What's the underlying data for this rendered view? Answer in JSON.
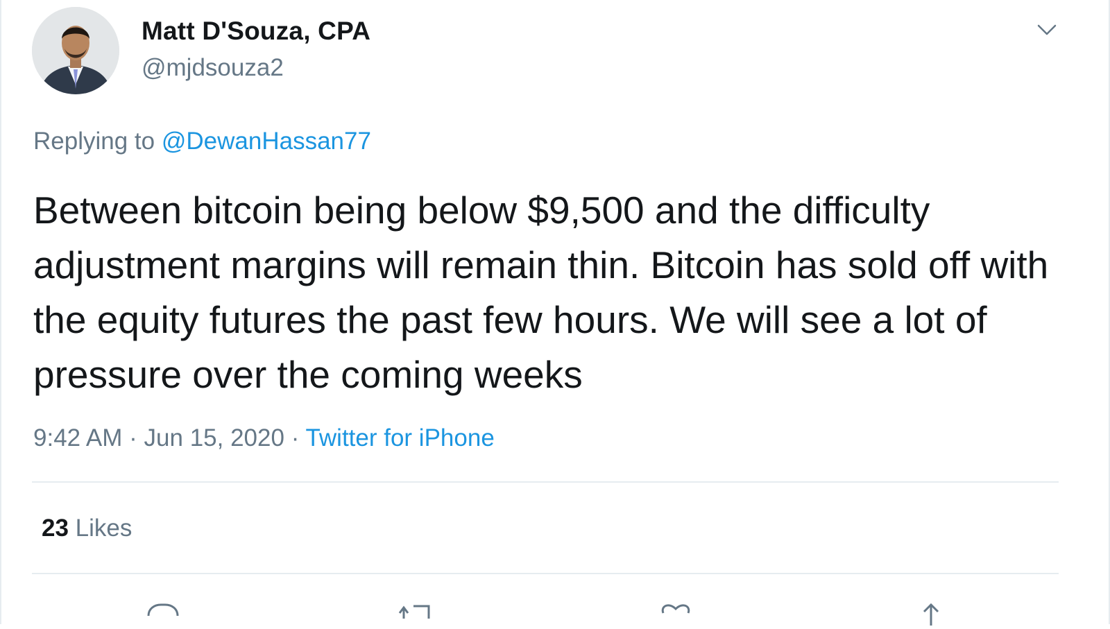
{
  "tweet": {
    "author": {
      "display_name": "Matt D'Souza, CPA",
      "handle": "@mjdsouza2"
    },
    "reply": {
      "prefix": "Replying to",
      "mention": "@DewanHassan77"
    },
    "text": "Between bitcoin being below $9,500 and the difficulty adjustment margins will remain thin. Bitcoin has sold off with the equity futures the past few hours. We will see a lot of pressure over the coming weeks",
    "meta": {
      "time": "9:42 AM",
      "separator": "·",
      "date": "Jun 15, 2020",
      "source": "Twitter for iPhone"
    },
    "stats": {
      "likes_count": "23",
      "likes_label": "Likes"
    }
  },
  "icons": {
    "caret": "chevron-down-icon",
    "reply": "reply-icon",
    "retweet": "retweet-icon",
    "like": "heart-icon",
    "share": "share-icon"
  },
  "colors": {
    "text": "#14171a",
    "secondary": "#657786",
    "link": "#1b95e0",
    "divider": "#e6ecf0"
  }
}
